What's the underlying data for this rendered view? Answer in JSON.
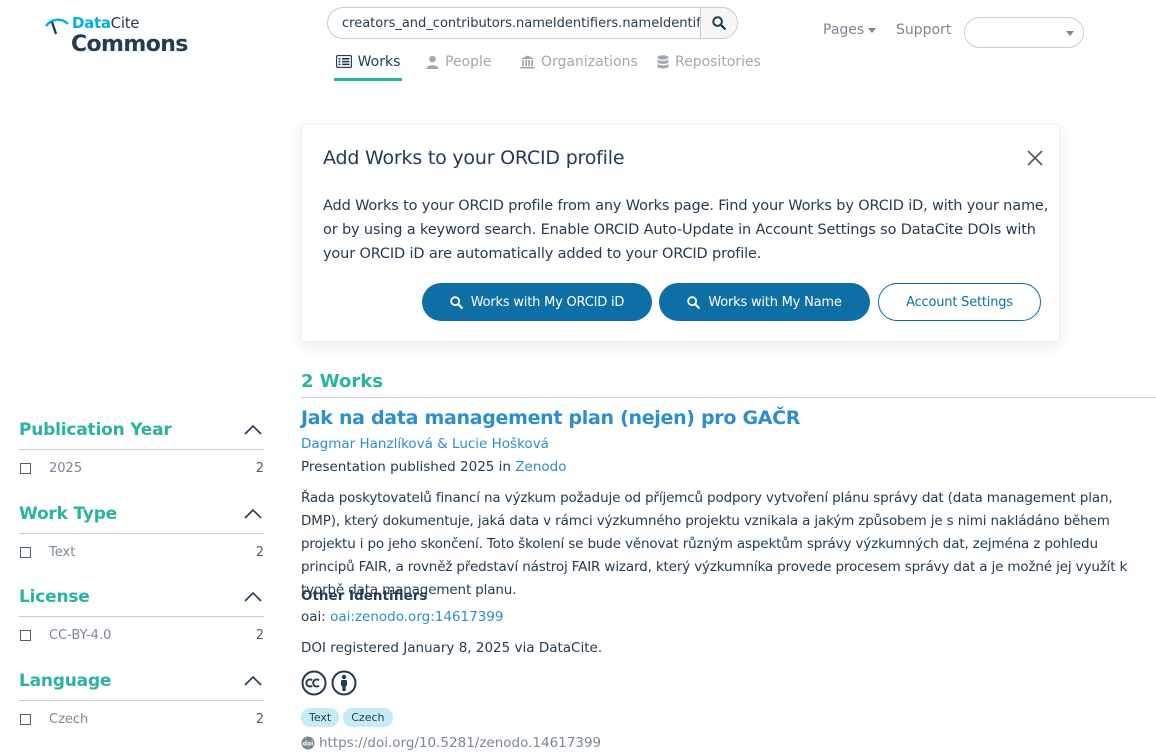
{
  "header": {
    "logo_top_a": "Data",
    "logo_top_b": "Cite",
    "logo_bottom": "Commons",
    "search_value": "creators_and_contributors.nameIdentifiers.nameIdentifier",
    "tabs": [
      {
        "label": "Works",
        "icon": "list-icon",
        "active": true
      },
      {
        "label": "People",
        "icon": "person-icon",
        "active": false
      },
      {
        "label": "Organizations",
        "icon": "institution-icon",
        "active": false
      },
      {
        "label": "Repositories",
        "icon": "database-icon",
        "active": false
      }
    ],
    "pages_label": "Pages",
    "support_label": "Support",
    "language_value": ""
  },
  "orcid_panel": {
    "title": "Add Works to your ORCID profile",
    "text": "Add Works to your ORCID profile from any Works page. Find your Works by ORCID iD, with your name, or by using a keyword search. Enable ORCID Auto-Update in Account Settings so DataCite DOIs with your ORCID iD are automatically added to your ORCID profile.",
    "btn_orcid": "Works with My ORCID iD",
    "btn_name": "Works with My Name",
    "btn_settings": "Account Settings"
  },
  "facets": [
    {
      "title": "Publication Year",
      "item": "2025",
      "count": "2"
    },
    {
      "title": "Work Type",
      "item": "Text",
      "count": "2"
    },
    {
      "title": "License",
      "item": "CC-BY-4.0",
      "count": "2"
    },
    {
      "title": "Language",
      "item": "Czech",
      "count": "2"
    }
  ],
  "results": {
    "count_label": "2 Works",
    "work": {
      "title": "Jak na data management plan (nejen) pro GAČR",
      "authors": "Dagmar Hanzlíková & Lucie Hošková",
      "published_prefix": "Presentation published 2025 in",
      "publisher": "Zenodo",
      "description": "Řada poskytovatelů financí na výzkum požaduje od příjemců podpory vytvoření plánu správy dat (data management plan, DMP), který dokumentuje, jaká data v rámci výzkumného projektu vznikala a jakým způsobem je s nimi nakládáno během projektu i po jeho skončení. Toto školení se bude věnovat různým aspektům správy výzkumných dat, zejména z pohledu principů FAIR, a rovněž představí nástroj FAIR wizard, který výzkumníka provede procesem správy dat a je možné jej využít k tvorbě data management planu.",
      "other_identifiers_label": "Other Identifiers",
      "oai_prefix": "oai:",
      "oai_value": "oai:zenodo.org:14617399",
      "doi_registered": "DOI registered January 8, 2025 via DataCite.",
      "license_icons": [
        "cc-icon",
        "by-attribution-icon"
      ],
      "tags": [
        "Text",
        "Czech"
      ],
      "doi_url": "https://doi.org/10.5281/zenodo.14617399"
    }
  },
  "colors": {
    "primary_button": "#0e6fa6",
    "link": "#2c8ecf",
    "accent_teal": "#29b3a0",
    "tag_bg": "#c6ecf6"
  }
}
